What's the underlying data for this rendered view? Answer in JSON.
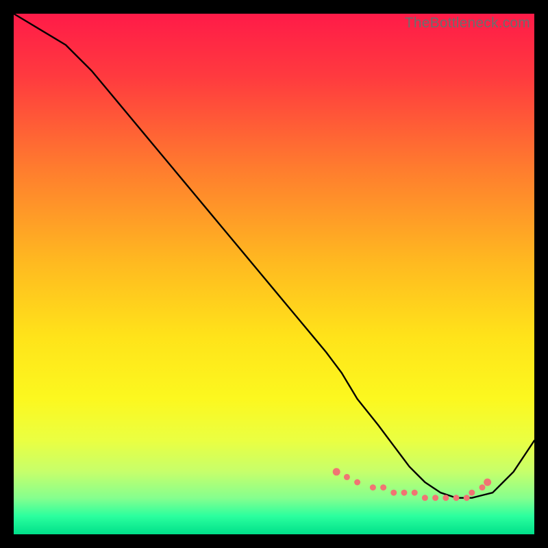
{
  "watermark": "TheBottleneck.com",
  "chart_data": {
    "type": "line",
    "title": "",
    "xlabel": "",
    "ylabel": "",
    "xlim": [
      0,
      100
    ],
    "ylim": [
      0,
      100
    ],
    "grid": false,
    "legend": false,
    "curve": {
      "name": "bottleneck-curve",
      "x": [
        0,
        5,
        10,
        15,
        20,
        25,
        30,
        35,
        40,
        45,
        50,
        55,
        60,
        63,
        66,
        70,
        73,
        76,
        79,
        82,
        85,
        88,
        92,
        96,
        100
      ],
      "y": [
        100,
        97,
        94,
        89,
        83,
        77,
        71,
        65,
        59,
        53,
        47,
        41,
        35,
        31,
        26,
        21,
        17,
        13,
        10,
        8,
        7,
        7,
        8,
        12,
        18
      ]
    },
    "marker_band": {
      "name": "optimal-range-markers",
      "color": "#f07573",
      "x": [
        62,
        64,
        66,
        69,
        71,
        73,
        75,
        77,
        79,
        81,
        83,
        85,
        87,
        88,
        90,
        91
      ],
      "y": [
        12,
        11,
        10,
        9,
        9,
        8,
        8,
        8,
        7,
        7,
        7,
        7,
        7,
        8,
        9,
        10
      ]
    },
    "background_gradient": {
      "stops": [
        {
          "offset": 0.0,
          "color": "#ff1b48"
        },
        {
          "offset": 0.12,
          "color": "#ff3a3f"
        },
        {
          "offset": 0.3,
          "color": "#ff7d2e"
        },
        {
          "offset": 0.48,
          "color": "#ffba20"
        },
        {
          "offset": 0.62,
          "color": "#ffe31a"
        },
        {
          "offset": 0.74,
          "color": "#fcf81f"
        },
        {
          "offset": 0.82,
          "color": "#eaff42"
        },
        {
          "offset": 0.88,
          "color": "#c6ff6b"
        },
        {
          "offset": 0.93,
          "color": "#86ff8e"
        },
        {
          "offset": 0.965,
          "color": "#2bff9e"
        },
        {
          "offset": 1.0,
          "color": "#00e08a"
        }
      ]
    }
  }
}
